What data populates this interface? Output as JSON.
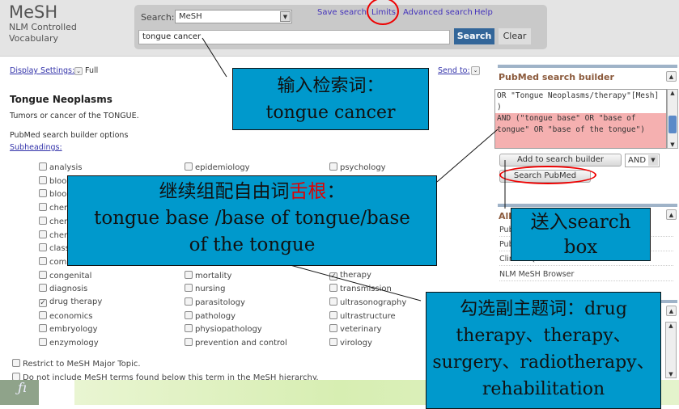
{
  "header": {
    "logo": "MeSH",
    "subtitle_line1": "NLM Controlled",
    "subtitle_line2": "Vocabulary",
    "search_label": "Search:",
    "database": "MeSH",
    "term": "tongue cancer",
    "search_button": "Search",
    "clear_button": "Clear",
    "links": [
      "Save search",
      "Limits",
      "Advanced search",
      "Help"
    ]
  },
  "toolbar": {
    "display_settings": "Display Settings:",
    "display_value": "Full",
    "send_to": "Send to:"
  },
  "record": {
    "title": "Tongue Neoplasms",
    "definition": "Tumors or cancer of the TONGUE.",
    "builder_options": "PubMed search builder options",
    "subheadings_label": "Subheadings:"
  },
  "subheadings": {
    "col1": [
      {
        "label": "analysis",
        "checked": false
      },
      {
        "label": "bloo",
        "checked": false
      },
      {
        "label": "bloo",
        "checked": false
      },
      {
        "label": "chen",
        "checked": false
      },
      {
        "label": "chen",
        "checked": false
      },
      {
        "label": "chen",
        "checked": false
      },
      {
        "label": "class",
        "checked": false
      },
      {
        "label": "comp",
        "checked": false
      },
      {
        "label": "congenital",
        "checked": false
      },
      {
        "label": "diagnosis",
        "checked": false
      },
      {
        "label": "drug therapy",
        "checked": true
      },
      {
        "label": "economics",
        "checked": false
      },
      {
        "label": "embryology",
        "checked": false
      },
      {
        "label": "enzymology",
        "checked": false
      }
    ],
    "col2": [
      {
        "label": "epidemiology",
        "checked": false
      },
      {
        "label": "mortality",
        "checked": false
      },
      {
        "label": "nursing",
        "checked": false
      },
      {
        "label": "parasitology",
        "checked": false
      },
      {
        "label": "pathology",
        "checked": false
      },
      {
        "label": "physiopathology",
        "checked": false
      },
      {
        "label": "prevention and control",
        "checked": false
      }
    ],
    "col3": [
      {
        "label": "psychology",
        "checked": false
      },
      {
        "label": "therapy",
        "checked": true
      },
      {
        "label": "transmission",
        "checked": false
      },
      {
        "label": "ultrasonography",
        "checked": false
      },
      {
        "label": "ultrastructure",
        "checked": false
      },
      {
        "label": "veterinary",
        "checked": false
      },
      {
        "label": "virology",
        "checked": false
      }
    ]
  },
  "options": {
    "restrict": "Restrict to MeSH Major Topic.",
    "no_explode": "Do not include MeSH terms found below this term in the MeSH hierarchy."
  },
  "builder": {
    "title": "PubMed search builder",
    "text_before": "OR  \"Tongue Neoplasms/therapy\"[Mesh] )",
    "text_highlight": "AND (\"tongue base\" OR \"base of tongue\" OR \"base of the tongue\")",
    "add_button": "Add to search builder",
    "operator": "AND",
    "search_button": "Search PubMed"
  },
  "links_section": {
    "title": "All",
    "links": [
      "Pub",
      "Pub",
      "Clinical Queries",
      "NLM MeSH Browser"
    ]
  },
  "callouts": {
    "c1_line1": "输入检索词：",
    "c1_line2": "tongue cancer",
    "c2_prefix": "继续组配自由词",
    "c2_red": "舌根",
    "c2_suffix": "：",
    "c2_line2": "tongue base /base of tongue/base of the tongue",
    "c3_line1": "送入search",
    "c3_line2": "box",
    "c4_text": "勾选副主题词：drug therapy、therapy、surgery、radiotherapy、rehabilitation"
  },
  "colors": {
    "callout_bg": "#0099cc",
    "highlight": "#f5b0b0",
    "annotation_red": "#e00000",
    "search_button": "#336699"
  }
}
